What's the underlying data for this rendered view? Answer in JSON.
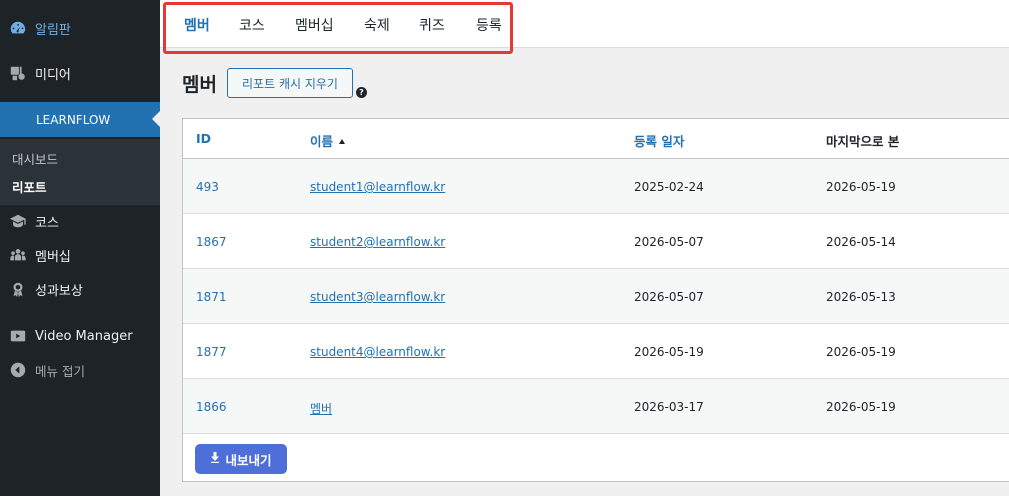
{
  "sidebar": {
    "items": [
      {
        "label": "알림판",
        "icon": "dashboard-icon"
      },
      {
        "label": "미디어",
        "icon": "media-icon"
      },
      {
        "label": "LEARNFLOW",
        "icon": ""
      },
      {
        "label": "코스",
        "icon": "graduation-cap-icon"
      },
      {
        "label": "멤버십",
        "icon": "groups-icon"
      },
      {
        "label": "성과보상",
        "icon": "award-icon"
      },
      {
        "label": "Video Manager",
        "icon": "video-icon"
      },
      {
        "label": "메뉴 접기",
        "icon": "collapse-icon"
      }
    ],
    "submenu": [
      {
        "label": "대시보드"
      },
      {
        "label": "리포트"
      }
    ]
  },
  "tabs": [
    "멤버",
    "코스",
    "멤버십",
    "숙제",
    "퀴즈",
    "등록"
  ],
  "page": {
    "title": "멤버",
    "clear_cache_label": "리포트 캐시 지우기",
    "help": "?"
  },
  "table": {
    "headers": {
      "id": "ID",
      "name": "이름",
      "registered": "등록 일자",
      "last_seen": "마지막으로 본"
    },
    "rows": [
      {
        "id": "493",
        "name": "student1@learnflow.kr",
        "registered": "2025-02-24",
        "last_seen": "2026-05-19"
      },
      {
        "id": "1867",
        "name": "student2@learnflow.kr",
        "registered": "2026-05-07",
        "last_seen": "2026-05-14"
      },
      {
        "id": "1871",
        "name": "student3@learnflow.kr",
        "registered": "2026-05-07",
        "last_seen": "2026-05-13"
      },
      {
        "id": "1877",
        "name": "student4@learnflow.kr",
        "registered": "2026-05-19",
        "last_seen": "2026-05-19"
      },
      {
        "id": "1866",
        "name": "멤버",
        "registered": "2026-03-17",
        "last_seen": "2026-05-19"
      }
    ]
  },
  "export_label": "내보내기",
  "colors": {
    "accent": "#2271b1",
    "sidebar": "#1d2327",
    "highlight": "#e53935",
    "export": "#4f6fd8"
  }
}
